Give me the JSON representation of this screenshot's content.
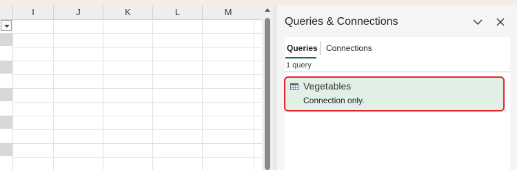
{
  "spreadsheet": {
    "columns": [
      "I",
      "J",
      "K",
      "L",
      "M"
    ]
  },
  "pane": {
    "title": "Queries & Connections",
    "tabs": [
      {
        "label": "Queries",
        "active": true
      },
      {
        "label": "Connections",
        "active": false
      }
    ],
    "query_count": "1 query",
    "queries": [
      {
        "name": "Vegetables",
        "status": "Connection only."
      }
    ],
    "icons": {
      "collapse": "chevron-down-icon",
      "close": "close-icon",
      "query": "table-icon"
    }
  },
  "colors": {
    "tab_underline": "#1e7145",
    "query_card_bg": "#e1efe6",
    "highlight_border": "#e3242b"
  }
}
